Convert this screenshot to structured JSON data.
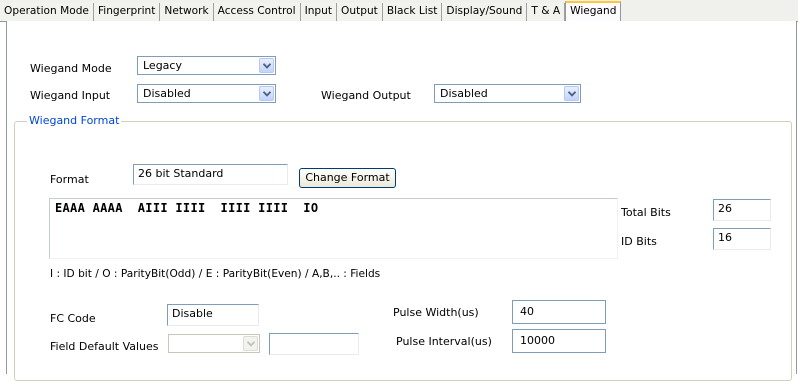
{
  "tabs": [
    "Operation Mode",
    "Fingerprint",
    "Network",
    "Access Control",
    "Input",
    "Output",
    "Black List",
    "Display/Sound",
    "T & A",
    "Wiegand"
  ],
  "active_tab": "Wiegand",
  "wiegand_mode": {
    "label": "Wiegand Mode",
    "value": "Legacy"
  },
  "wiegand_input": {
    "label": "Wiegand Input",
    "value": "Disabled"
  },
  "wiegand_output": {
    "label": "Wiegand Output",
    "value": "Disabled"
  },
  "wiegand_format": {
    "legend": "Wiegand Format",
    "format_label": "Format",
    "format_value": "26 bit Standard",
    "change_format_label": "Change Format",
    "format_pattern": "EAAA AAAA  AIII IIII  IIII IIII  IO",
    "total_bits_label": "Total Bits",
    "total_bits_value": "26",
    "id_bits_label": "ID Bits",
    "id_bits_value": "16",
    "legend_text": "I : ID bit  /  O : ParityBit(Odd)  /  E : ParityBit(Even)  /  A,B,.. : Fields",
    "fc_code_label": "FC Code",
    "fc_code_value": "Disable",
    "field_default_label": "Field Default Values",
    "field_default_combo_value": "",
    "field_default_text_value": "",
    "pulse_width_label": "Pulse Width(us)",
    "pulse_width_value": "40",
    "pulse_interval_label": "Pulse Interval(us)",
    "pulse_interval_value": "10000"
  }
}
